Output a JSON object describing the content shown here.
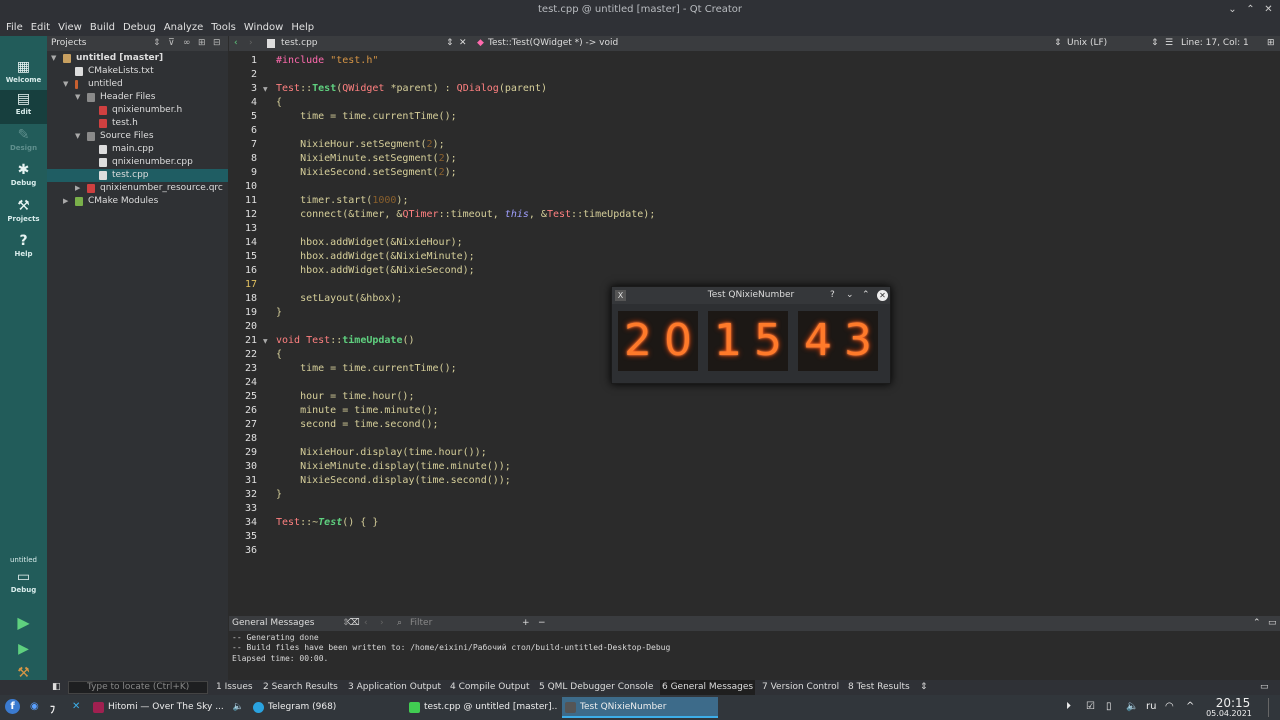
{
  "window": {
    "title": "test.cpp @ untitled [master] - Qt Creator"
  },
  "menu": [
    "File",
    "Edit",
    "View",
    "Build",
    "Debug",
    "Analyze",
    "Tools",
    "Window",
    "Help"
  ],
  "modes": [
    {
      "label": "Welcome",
      "icon": "grid-icon"
    },
    {
      "label": "Edit",
      "icon": "edit-icon"
    },
    {
      "label": "Design",
      "icon": "pencil-icon"
    },
    {
      "label": "Debug",
      "icon": "bug-icon"
    },
    {
      "label": "Projects",
      "icon": "wrench-icon"
    },
    {
      "label": "Help",
      "icon": "help-icon"
    }
  ],
  "kit": {
    "project": "untitled",
    "config": "Debug"
  },
  "projects": {
    "title": "Projects",
    "tree": [
      "untitled [master]",
      "CMakeLists.txt",
      "untitled",
      "Header Files",
      "qnixienumber.h",
      "test.h",
      "Source Files",
      "main.cpp",
      "qnixienumber.cpp",
      "test.cpp",
      "qnixienumber_resource.qrc",
      "CMake Modules"
    ]
  },
  "editor": {
    "file": "test.cpp",
    "symbol": "Test::Test(QWidget *) -> void",
    "eol": "Unix (LF)",
    "position": "Line: 17, Col: 1",
    "lines": [
      "1",
      "2",
      "3",
      "4",
      "5",
      "6",
      "7",
      "8",
      "9",
      "10",
      "11",
      "12",
      "13",
      "14",
      "15",
      "16",
      "17",
      "18",
      "19",
      "20",
      "21",
      "22",
      "23",
      "24",
      "25",
      "26",
      "27",
      "28",
      "29",
      "30",
      "31",
      "32",
      "33",
      "34",
      "35",
      "36"
    ]
  },
  "output": {
    "title": "General Messages",
    "filter": "Filter",
    "lines": [
      "-- Generating done",
      "-- Build files have been written to: /home/eixini/Рабочий стол/build-untitled-Desktop-Debug",
      "Elapsed time: 00:00."
    ]
  },
  "statusbar": {
    "locate": "Type to locate (Ctrl+K)",
    "tabs": [
      "1  Issues",
      "2  Search Results",
      "3  Application Output",
      "4  Compile Output",
      "5  QML Debugger Console",
      "6  General Messages",
      "7  Version Control",
      "8  Test Results"
    ]
  },
  "dialog": {
    "title": "Test QNixieNumber",
    "help": "?",
    "digits": [
      "2",
      "0",
      "1",
      "5",
      "4",
      "3"
    ]
  },
  "taskbar": {
    "tasks": [
      "Hitomi — Over The Sky ...",
      "Telegram (968)",
      "test.cpp @ untitled [master]...",
      "Test QNixieNumber"
    ],
    "lang": "ru",
    "time": "20:15",
    "date": "05.04.2021"
  }
}
